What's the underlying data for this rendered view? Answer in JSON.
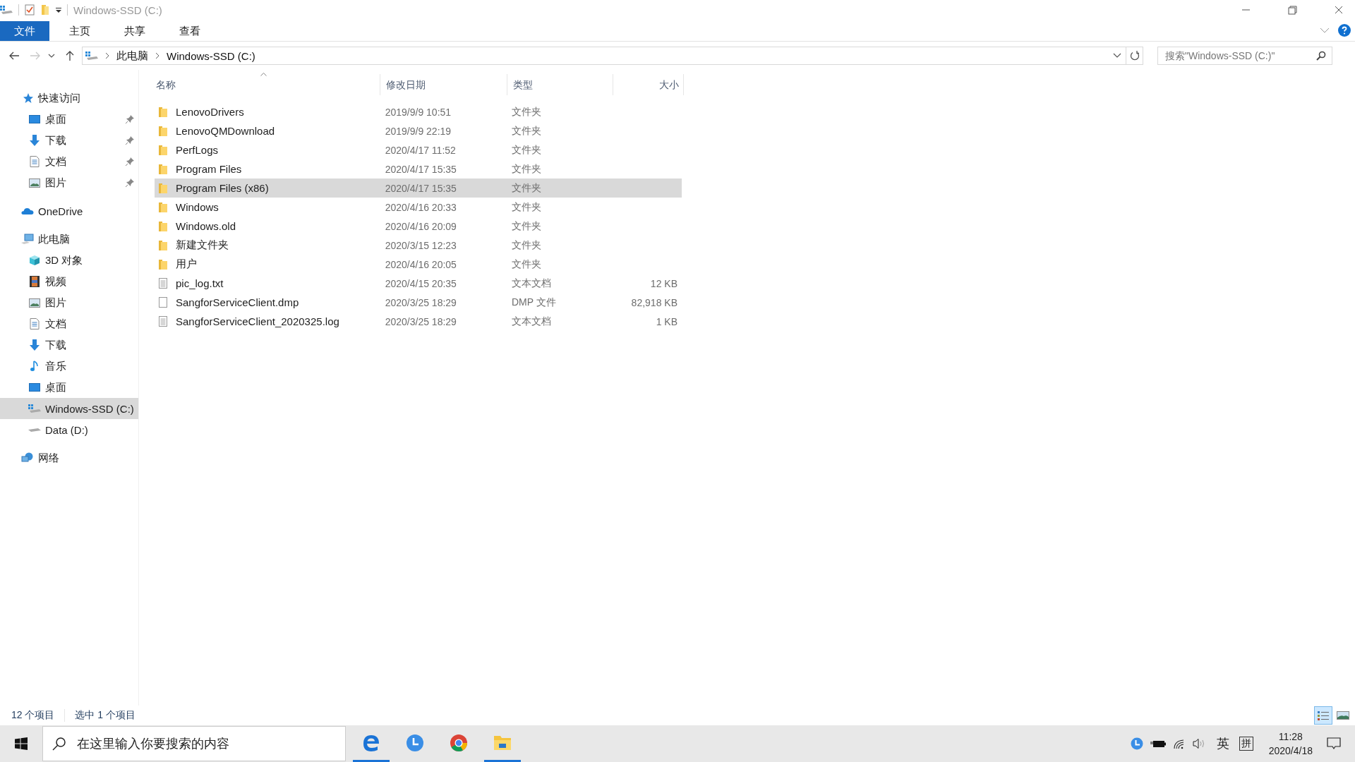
{
  "window": {
    "title": "Windows-SSD (C:)"
  },
  "ribbon_tabs": [
    {
      "label": "文件",
      "selected": true
    },
    {
      "label": "主页",
      "selected": false
    },
    {
      "label": "共享",
      "selected": false
    },
    {
      "label": "查看",
      "selected": false
    }
  ],
  "nav": {
    "forward_disabled": true
  },
  "address": {
    "path": [
      "此电脑",
      "Windows-SSD (C:)"
    ]
  },
  "search": {
    "placeholder": "搜索\"Windows-SSD (C:)\""
  },
  "sidebar": {
    "groups": [
      {
        "label": "快速访问",
        "kind": "star",
        "selected": false,
        "children": [
          {
            "label": "桌面",
            "kind": "desktop",
            "pinned": true,
            "selected": false
          },
          {
            "label": "下载",
            "kind": "download",
            "pinned": true,
            "selected": false
          },
          {
            "label": "文档",
            "kind": "document",
            "pinned": true,
            "selected": false
          },
          {
            "label": "图片",
            "kind": "pictures",
            "pinned": true,
            "selected": false
          }
        ]
      },
      {
        "label": "OneDrive",
        "kind": "cloud",
        "selected": false
      },
      {
        "label": "此电脑",
        "kind": "computer",
        "selected": false,
        "children": [
          {
            "label": "3D 对象",
            "kind": "cube",
            "selected": false
          },
          {
            "label": "视频",
            "kind": "video",
            "selected": false
          },
          {
            "label": "图片",
            "kind": "pictures",
            "selected": false
          },
          {
            "label": "文档",
            "kind": "document",
            "selected": false
          },
          {
            "label": "下载",
            "kind": "download",
            "selected": false
          },
          {
            "label": "音乐",
            "kind": "music",
            "selected": false
          },
          {
            "label": "桌面",
            "kind": "desktop",
            "selected": false
          },
          {
            "label": "Windows-SSD (C:)",
            "kind": "sysdrive",
            "selected": true
          },
          {
            "label": "Data (D:)",
            "kind": "drive",
            "selected": false
          }
        ]
      },
      {
        "label": "网络",
        "kind": "network",
        "selected": false
      }
    ]
  },
  "table": {
    "columns": [
      "名称",
      "修改日期",
      "类型",
      "大小"
    ],
    "rows": [
      {
        "kind": "folder",
        "name": "LenovoDrivers",
        "date": "2019/9/9 10:51",
        "type": "文件夹",
        "selected": false
      },
      {
        "kind": "folder",
        "name": "LenovoQMDownload",
        "date": "2019/9/9 22:19",
        "type": "文件夹",
        "selected": false
      },
      {
        "kind": "folder",
        "name": "PerfLogs",
        "date": "2020/4/17 11:52",
        "type": "文件夹",
        "selected": false
      },
      {
        "kind": "folder",
        "name": "Program Files",
        "date": "2020/4/17 15:35",
        "type": "文件夹",
        "selected": false
      },
      {
        "kind": "folder",
        "name": "Program Files (x86)",
        "date": "2020/4/17 15:35",
        "type": "文件夹",
        "selected": true
      },
      {
        "kind": "folder",
        "name": "Windows",
        "date": "2020/4/16 20:33",
        "type": "文件夹",
        "selected": false
      },
      {
        "kind": "folder",
        "name": "Windows.old",
        "date": "2020/4/16 20:09",
        "type": "文件夹",
        "selected": false
      },
      {
        "kind": "folder",
        "name": "新建文件夹",
        "date": "2020/3/15 12:23",
        "type": "文件夹",
        "selected": false
      },
      {
        "kind": "folder",
        "name": "用户",
        "date": "2020/4/16 20:05",
        "type": "文件夹",
        "selected": false
      },
      {
        "kind": "text",
        "name": "pic_log.txt",
        "date": "2020/4/15 20:35",
        "type": "文本文档",
        "size": "12 KB",
        "selected": false
      },
      {
        "kind": "blank",
        "name": "SangforServiceClient.dmp",
        "date": "2020/3/25 18:29",
        "type": "DMP 文件",
        "size": "82,918 KB",
        "selected": false
      },
      {
        "kind": "text",
        "name": "SangforServiceClient_2020325.log",
        "date": "2020/3/25 18:29",
        "type": "文本文档",
        "size": "1 KB",
        "selected": false
      }
    ]
  },
  "status_bar": {
    "item_count": "12 个项目",
    "selection": "选中 1 个项目"
  },
  "view_buttons": [
    {
      "kind": "details",
      "selected": true
    },
    {
      "kind": "large",
      "selected": false
    }
  ],
  "taskbar": {
    "search_placeholder": "在这里输入你要搜索的内容",
    "apps": [
      {
        "kind": "edge",
        "active": true
      },
      {
        "kind": "clock",
        "active": false
      },
      {
        "kind": "chrome",
        "active": false
      },
      {
        "kind": "explorer",
        "active": true
      }
    ],
    "ime_language": "英",
    "ime_mode": "拼",
    "time": "11:28",
    "date": "2020/4/18"
  }
}
